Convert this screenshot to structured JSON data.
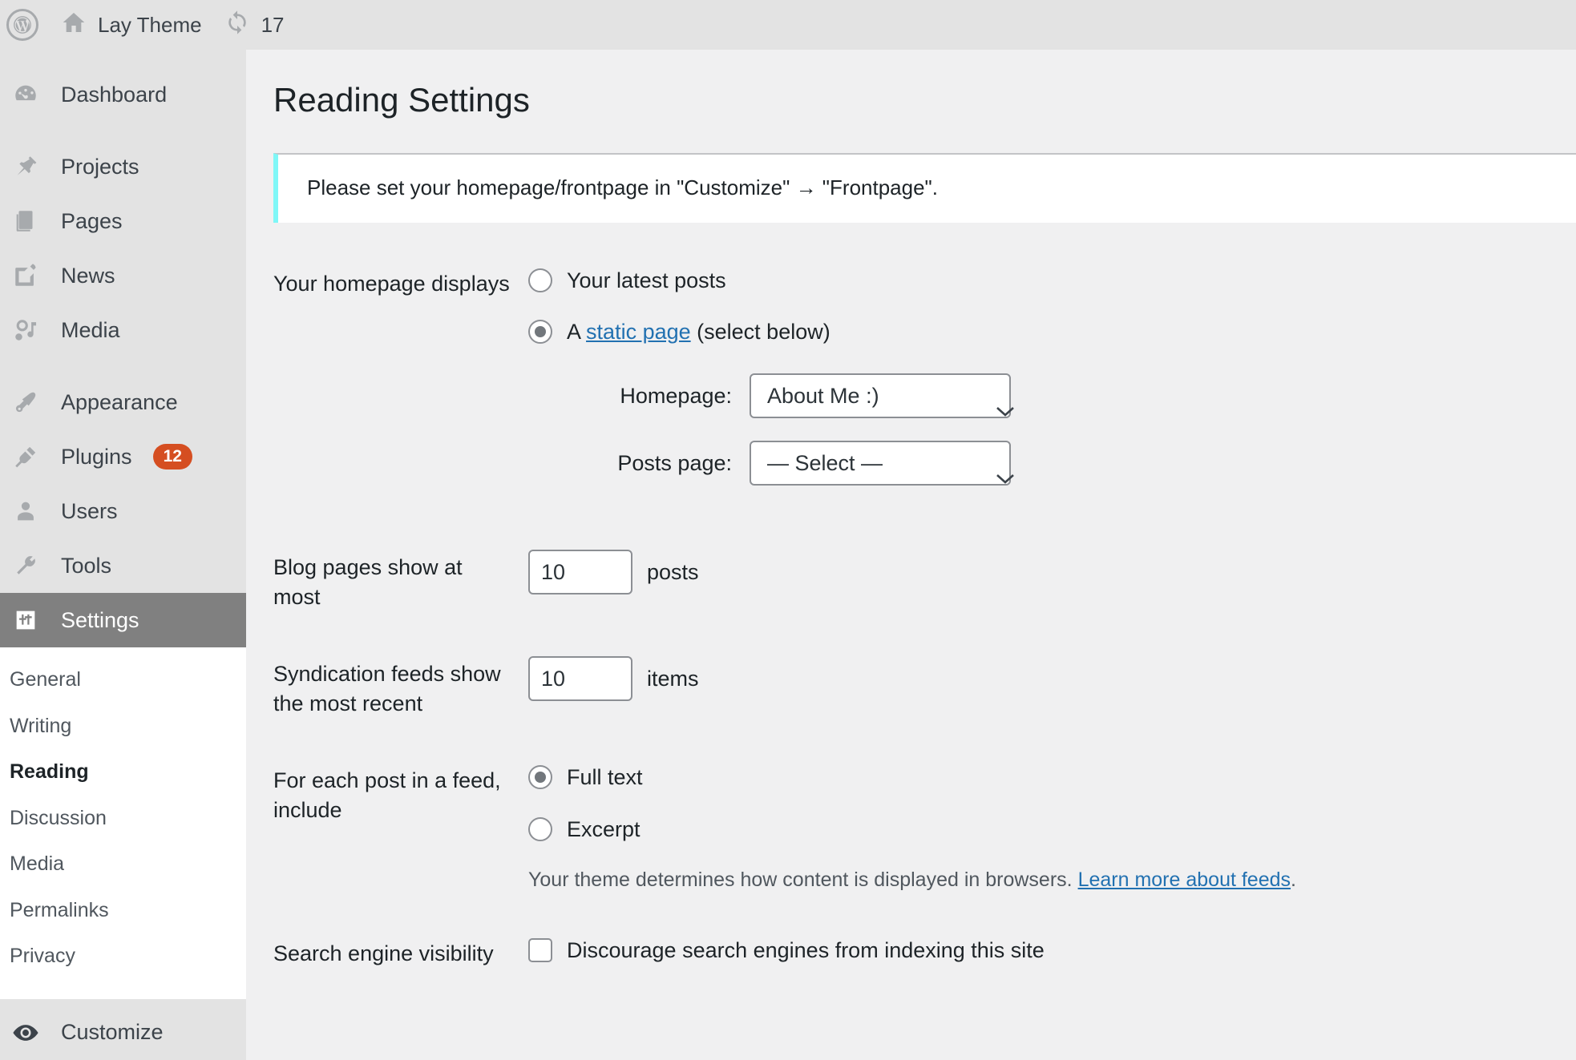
{
  "adminbar": {
    "wp_logo": "W",
    "site_name": "Lay Theme",
    "home_icon": "home-icon",
    "updates_icon": "updates-icon",
    "updates_count": "17"
  },
  "sidebar": {
    "items": [
      {
        "label": "Dashboard",
        "icon": "dashboard-icon",
        "badge": ""
      },
      {
        "label": "Projects",
        "icon": "pin-icon",
        "badge": ""
      },
      {
        "label": "Pages",
        "icon": "pages-icon",
        "badge": ""
      },
      {
        "label": "News",
        "icon": "post-icon",
        "badge": ""
      },
      {
        "label": "Media",
        "icon": "media-icon",
        "badge": ""
      },
      {
        "label": "Appearance",
        "icon": "brush-icon",
        "badge": ""
      },
      {
        "label": "Plugins",
        "icon": "plug-icon",
        "badge": "12"
      },
      {
        "label": "Users",
        "icon": "user-icon",
        "badge": ""
      },
      {
        "label": "Tools",
        "icon": "wrench-icon",
        "badge": ""
      },
      {
        "label": "Settings",
        "icon": "settings-icon",
        "badge": ""
      }
    ],
    "submenu": [
      {
        "label": "General"
      },
      {
        "label": "Writing"
      },
      {
        "label": "Reading"
      },
      {
        "label": "Discussion"
      },
      {
        "label": "Media"
      },
      {
        "label": "Permalinks"
      },
      {
        "label": "Privacy"
      }
    ],
    "customize": {
      "label": "Customize",
      "icon": "eye-icon"
    },
    "accent_badge_color": "#d54e21",
    "current_menu_bg": "#808080"
  },
  "page": {
    "title": "Reading Settings",
    "notice": "Please set your homepage/frontpage in \"Customize\" → \"Frontpage\".",
    "notice_border_color": "#7ff7f7"
  },
  "form": {
    "homepage_displays": {
      "label": "Your homepage displays",
      "option_latest": "Your latest posts",
      "option_static_prefix": "A",
      "option_static_link": "static page",
      "option_static_suffix": "(select below)",
      "selected": "static"
    },
    "homepage_select": {
      "label": "Homepage:",
      "value": "About Me :)"
    },
    "posts_page_select": {
      "label": "Posts page:",
      "value": "— Select —"
    },
    "blog_pages": {
      "label": "Blog pages show at most",
      "value": "10",
      "unit": "posts"
    },
    "syndication": {
      "label": "Syndication feeds show the most recent",
      "value": "10",
      "unit": "items"
    },
    "feed_include": {
      "label": "For each post in a feed, include",
      "option_full": "Full text",
      "option_excerpt": "Excerpt",
      "selected": "full",
      "helper_prefix": "Your theme determines how content is displayed in browsers.",
      "helper_link": "Learn more about feeds",
      "helper_suffix": "."
    },
    "search_visibility": {
      "label": "Search engine visibility",
      "checkbox_label": "Discourage search engines from indexing this site",
      "checked": false
    }
  },
  "colors": {
    "link": "#2271b1",
    "page_bg": "#f0f0f1",
    "sidebar_bg": "#e3e3e3"
  }
}
